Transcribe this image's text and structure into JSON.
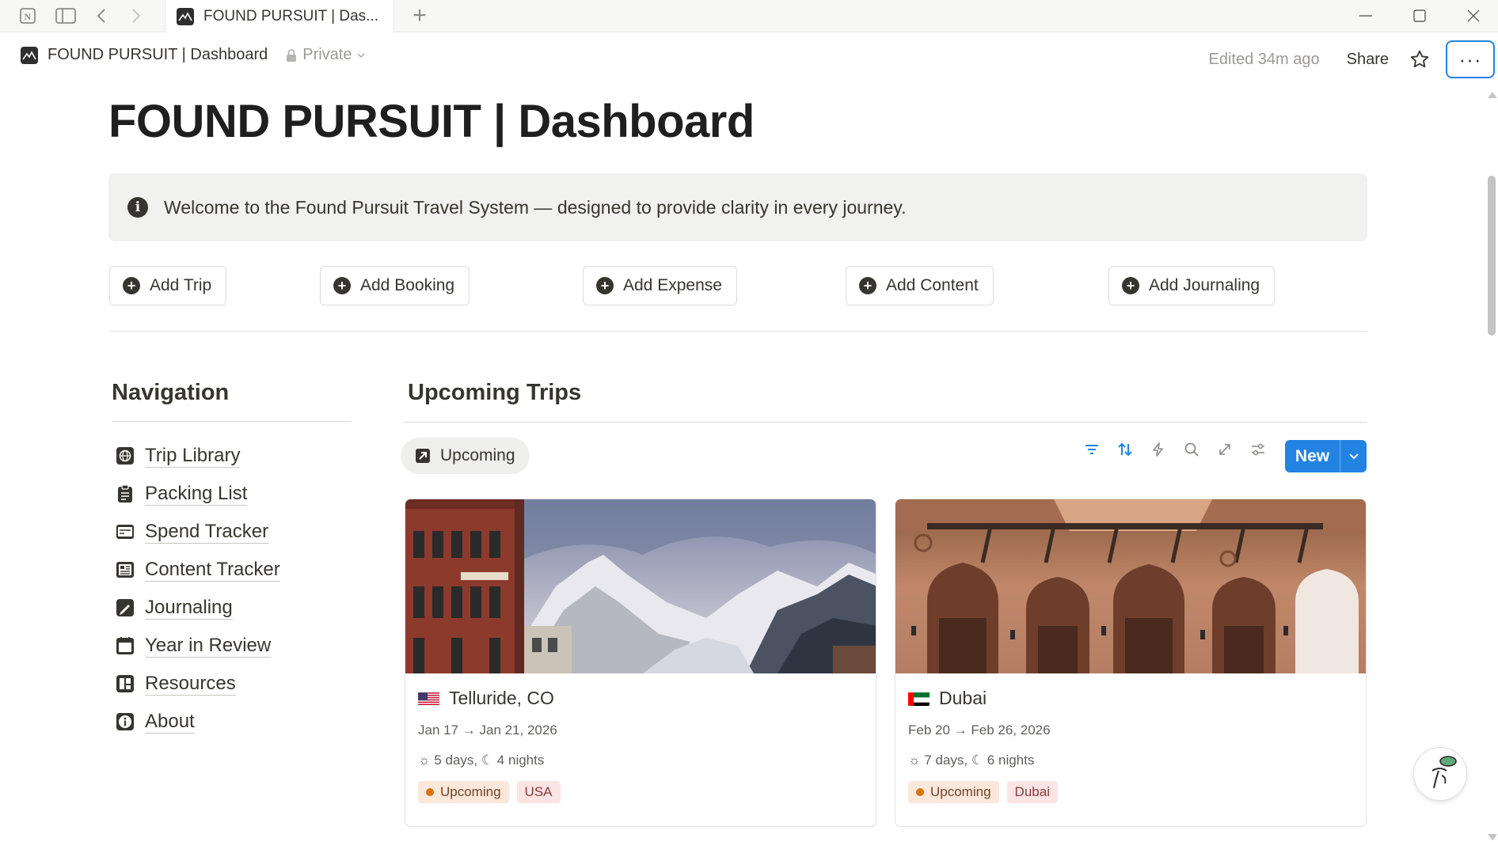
{
  "window": {
    "tab_title": "FOUND PURSUIT | Das...",
    "new_tab_label": "+",
    "minimize": "—",
    "close": "✕"
  },
  "topbar": {
    "page_name": "FOUND PURSUIT | Dashboard",
    "privacy": "Private",
    "edited": "Edited 34m ago",
    "share": "Share",
    "more": "···"
  },
  "page": {
    "title": "FOUND PURSUIT | Dashboard",
    "callout": "Welcome to the Found Pursuit Travel System — designed to provide clarity in every journey."
  },
  "actions": [
    {
      "label": "Add Trip"
    },
    {
      "label": "Add Booking"
    },
    {
      "label": "Add Expense"
    },
    {
      "label": "Add Content"
    },
    {
      "label": "Add Journaling"
    }
  ],
  "navigation": {
    "heading": "Navigation",
    "items": [
      {
        "label": "Trip Library",
        "icon": "globe-icon"
      },
      {
        "label": "Packing List",
        "icon": "clipboard-icon"
      },
      {
        "label": "Spend Tracker",
        "icon": "credit-card-icon"
      },
      {
        "label": "Content Tracker",
        "icon": "newspaper-icon"
      },
      {
        "label": "Journaling",
        "icon": "pen-icon"
      },
      {
        "label": "Year in Review",
        "icon": "calendar-icon"
      },
      {
        "label": "Resources",
        "icon": "books-icon"
      },
      {
        "label": "About",
        "icon": "info-icon"
      }
    ]
  },
  "upcoming": {
    "heading": "Upcoming Trips",
    "view_tab": "Upcoming",
    "new_button": "New",
    "cards": [
      {
        "title": "Telluride, CO",
        "flag": "us-flag-icon",
        "dates": "Jan 17 → Jan 21, 2026",
        "duration": "5 days, ☾ 4 nights",
        "status": "Upcoming",
        "location": "USA"
      },
      {
        "title": "Dubai",
        "flag": "uae-flag-icon",
        "dates": "Feb 20 → Feb 26, 2026",
        "duration": "7 days, ☾ 6 nights",
        "status": "Upcoming",
        "location": "Dubai"
      }
    ]
  },
  "colors": {
    "accent": "#2383e2",
    "status_upcoming_bg": "#fbe8db",
    "status_upcoming_dot": "#d9730d",
    "location_bg": "#fbe4e4"
  }
}
